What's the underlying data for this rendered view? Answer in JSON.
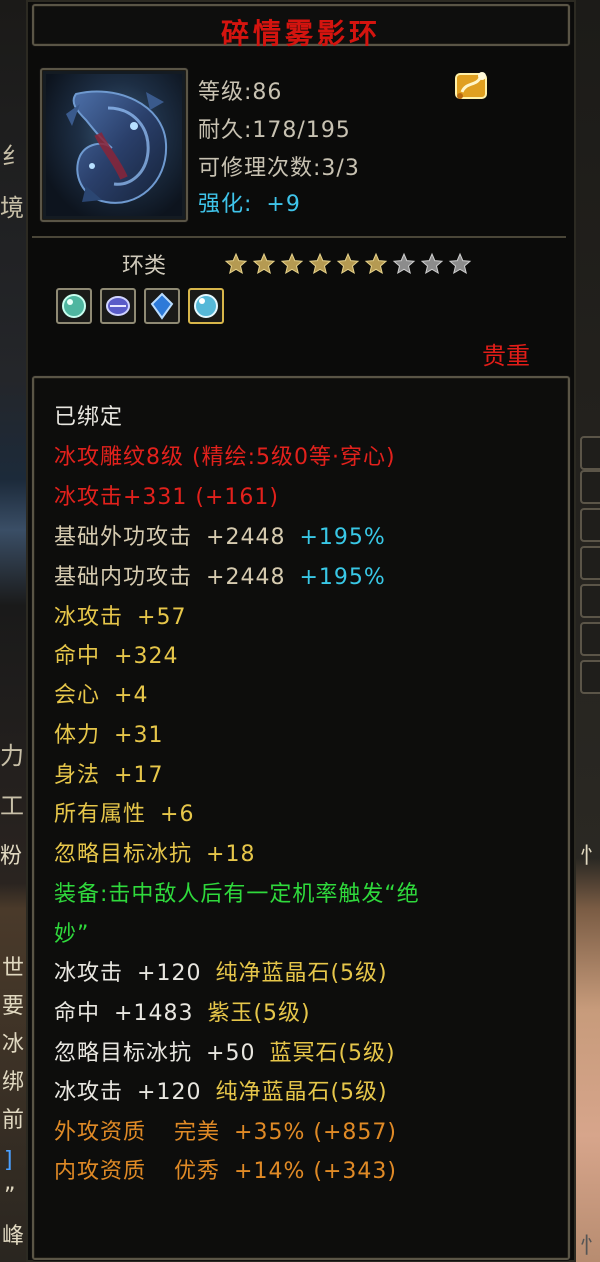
{
  "background": {
    "left_glyphs": [
      "纟",
      "境",
      "力",
      "工",
      "粉",
      "世",
      "要",
      "冰",
      "绑",
      "前",
      "]",
      "”",
      "峰"
    ],
    "right_glyphs": [
      "忄",
      "忄"
    ]
  },
  "item": {
    "name": "碎情雾影环",
    "level": "等级:86",
    "durability": "耐久:178/195",
    "repairs": "可修理次数:3/3",
    "enhance_label": "强化:",
    "enhance_value": "+9",
    "type": "环类",
    "stars_filled": 6,
    "stars_total": 9,
    "gems": [
      "green-gem-icon",
      "blue-violet-gem-icon",
      "blue-crystal-gem-icon",
      "teal-gem-icon"
    ],
    "rarity": "贵重"
  },
  "stats": {
    "bound": "已绑定",
    "engrave": "冰攻雕纹8级 (精绘:5级0等·穿心)",
    "ice_attack_main": "冰攻击+331 (+161)",
    "ext_label": "基础外功攻击",
    "ext_val": "+2448",
    "ext_pct": "+195%",
    "int_label": "基础内功攻击",
    "int_val": "+2448",
    "int_pct": "+195%",
    "extra": [
      {
        "label": "冰攻击",
        "value": "+57"
      },
      {
        "label": "命中",
        "value": "+324"
      },
      {
        "label": "会心",
        "value": "+4"
      },
      {
        "label": "体力",
        "value": "+31"
      },
      {
        "label": "身法",
        "value": "+17"
      },
      {
        "label": "所有属性",
        "value": "+6"
      },
      {
        "label": "忽略目标冰抗",
        "value": "+18"
      }
    ],
    "equip_effect_1": "装备:击中敌人后有一定机率触发“绝",
    "equip_effect_2": "妙”",
    "socket_lines": [
      {
        "label": "冰攻击",
        "value": "+120",
        "gem": "纯净蓝晶石(5级)"
      },
      {
        "label": "命中",
        "value": "+1483",
        "gem": "紫玉(5级)"
      },
      {
        "label": "忽略目标冰抗",
        "value": "+50",
        "gem": "蓝冥石(5级)"
      },
      {
        "label": "冰攻击",
        "value": "+120",
        "gem": "纯净蓝晶石(5级)"
      }
    ],
    "qual_ext": "外攻资质",
    "qual_ext_grade": "完美",
    "qual_ext_val": "+35% (+857)",
    "qual_int": "内攻资质",
    "qual_int_grade": "优秀",
    "qual_int_val": "+14% (+343)"
  },
  "colors": {
    "title": "#d4140f",
    "enhance": "#3fc4ea",
    "red": "#e2211c",
    "cyan": "#39c8e6",
    "yellow": "#e6c64a",
    "green": "#2fd93c",
    "orange": "#e08a26"
  }
}
